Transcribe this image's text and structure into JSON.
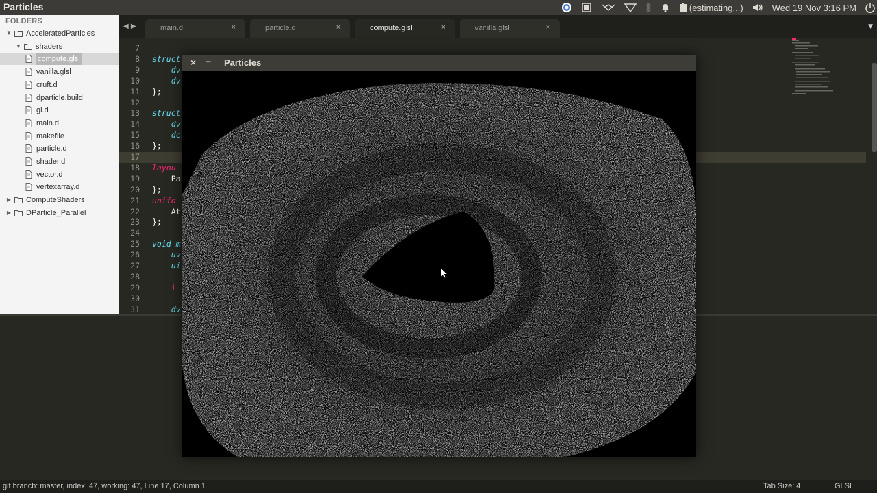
{
  "topbar": {
    "app_title": "Particles",
    "battery_label": "(estimating...)",
    "datetime": "Wed 19 Nov  3:16 PM"
  },
  "sidebar": {
    "header": "FOLDERS",
    "tree": [
      {
        "label": "AcceleratedParticles",
        "type": "folder",
        "expanded": true
      },
      {
        "label": "shaders",
        "type": "folder",
        "expanded": true
      },
      {
        "label": "compute.glsl",
        "type": "file",
        "selected": true
      },
      {
        "label": "vanilla.glsl",
        "type": "file"
      },
      {
        "label": "cruft.d",
        "type": "file"
      },
      {
        "label": "dparticle.build",
        "type": "file"
      },
      {
        "label": "gl.d",
        "type": "file"
      },
      {
        "label": "main.d",
        "type": "file"
      },
      {
        "label": "makefile",
        "type": "file"
      },
      {
        "label": "particle.d",
        "type": "file"
      },
      {
        "label": "shader.d",
        "type": "file"
      },
      {
        "label": "vector.d",
        "type": "file"
      },
      {
        "label": "vertexarray.d",
        "type": "file"
      },
      {
        "label": "ComputeShaders",
        "type": "folder",
        "expanded": false
      },
      {
        "label": "DParticle_Parallel",
        "type": "folder",
        "expanded": false
      }
    ]
  },
  "tabs": [
    {
      "label": "main.d",
      "active": false
    },
    {
      "label": "particle.d",
      "active": false
    },
    {
      "label": "compute.glsl",
      "active": true
    },
    {
      "label": "vanilla.glsl",
      "active": false
    }
  ],
  "editor": {
    "lines": [
      {
        "n": "7",
        "code": ""
      },
      {
        "n": "8",
        "code": "struct"
      },
      {
        "n": "9",
        "code": "    dv"
      },
      {
        "n": "10",
        "code": "    dv"
      },
      {
        "n": "11",
        "code": "};"
      },
      {
        "n": "12",
        "code": ""
      },
      {
        "n": "13",
        "code": "struct"
      },
      {
        "n": "14",
        "code": "    dv"
      },
      {
        "n": "15",
        "code": "    dc"
      },
      {
        "n": "16",
        "code": "};"
      },
      {
        "n": "17",
        "code": ""
      },
      {
        "n": "18",
        "code": "layou"
      },
      {
        "n": "19",
        "code": "    Pa"
      },
      {
        "n": "20",
        "code": "};"
      },
      {
        "n": "21",
        "code": "unifo"
      },
      {
        "n": "22",
        "code": "    At"
      },
      {
        "n": "23",
        "code": "};"
      },
      {
        "n": "24",
        "code": ""
      },
      {
        "n": "25",
        "code": "void m"
      },
      {
        "n": "26",
        "code": "    uv"
      },
      {
        "n": "27",
        "code": "    ui"
      },
      {
        "n": "28",
        "code": ""
      },
      {
        "n": "29",
        "code": "    i"
      },
      {
        "n": "30",
        "code": ""
      },
      {
        "n": "31",
        "code": "    dv"
      }
    ]
  },
  "particles_window": {
    "title": "Particles",
    "close_glyph": "×",
    "minimize_glyph": "−"
  },
  "statusbar": {
    "left": "git branch: master, index: 47, working: 47, Line 17, Column 1",
    "tab_size": "Tab Size: 4",
    "syntax": "GLSL"
  },
  "icons": [
    "chrome-icon",
    "cpu-icon",
    "network-icon",
    "wifi-icon",
    "bluetooth-icon",
    "bell-icon",
    "battery-icon",
    "volume-icon",
    "power-icon"
  ]
}
